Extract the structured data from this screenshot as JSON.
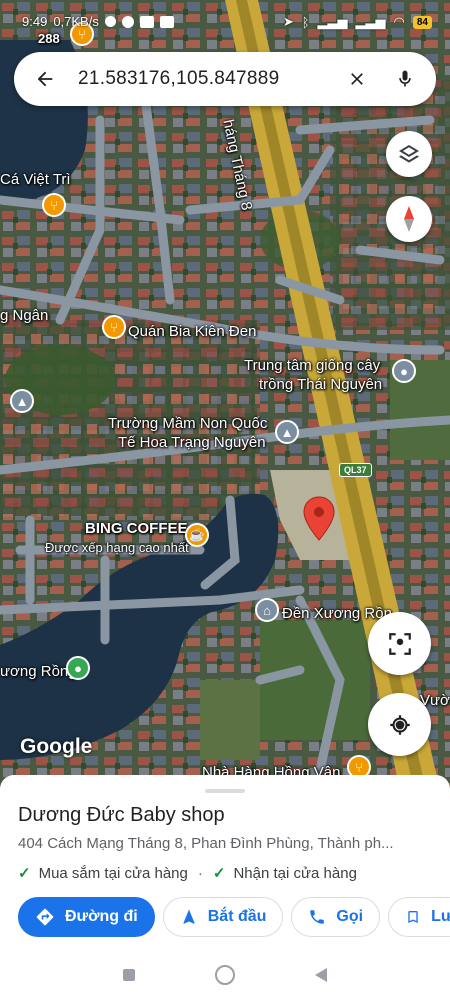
{
  "status_bar": {
    "time": "9:49",
    "speed": "0,7KB/s",
    "battery": "84"
  },
  "search": {
    "query": "21.583176,105.847889",
    "back_icon": "arrow-back-icon",
    "clear_icon": "close-icon",
    "voice_icon": "mic-icon"
  },
  "map": {
    "labels": {
      "route_288": "288",
      "ca_viet_tri": "Cá Việt Trì",
      "tang_thang_8": "háng Tháng 8",
      "quan_bia": "Quán Bia Kiên Đen",
      "ng_ngan": "g Ngân",
      "trung_tam_1": "Trung tâm giống cây",
      "trung_tam_2": "trồng Thái Nguyên",
      "truong_1": "Trường Mầm Non Quốc",
      "truong_2": "Tế Hoa Trạng Nguyên",
      "ql37": "QL37",
      "bing_coffee": "BING COFFEE",
      "bing_rating": "Được xếp hạng cao nhất",
      "den_xuong_rong": "Đền Xương Rồn",
      "uong_rong": "ương Rồng",
      "vuo": "Vườ",
      "nha_hang": "Nhà Hàng Hồng Vân",
      "google": "Google"
    },
    "colors": {
      "pin": "#ea4335",
      "food": "#f29900",
      "cafe": "#f29900",
      "park": "#34a853",
      "poi": "#7b8fa1"
    }
  },
  "place": {
    "name": "Dương Đức Baby shop",
    "address": "404 Cách Mạng Tháng 8, Phan Đình Phùng, Thành ph...",
    "features": [
      "Mua sắm tại cửa hàng",
      "Nhận tại cửa hàng"
    ],
    "actions": {
      "directions": "Đường đi",
      "start": "Bắt đầu",
      "call": "Gọi",
      "save": "Lư"
    }
  },
  "accent": "#1a73e8"
}
